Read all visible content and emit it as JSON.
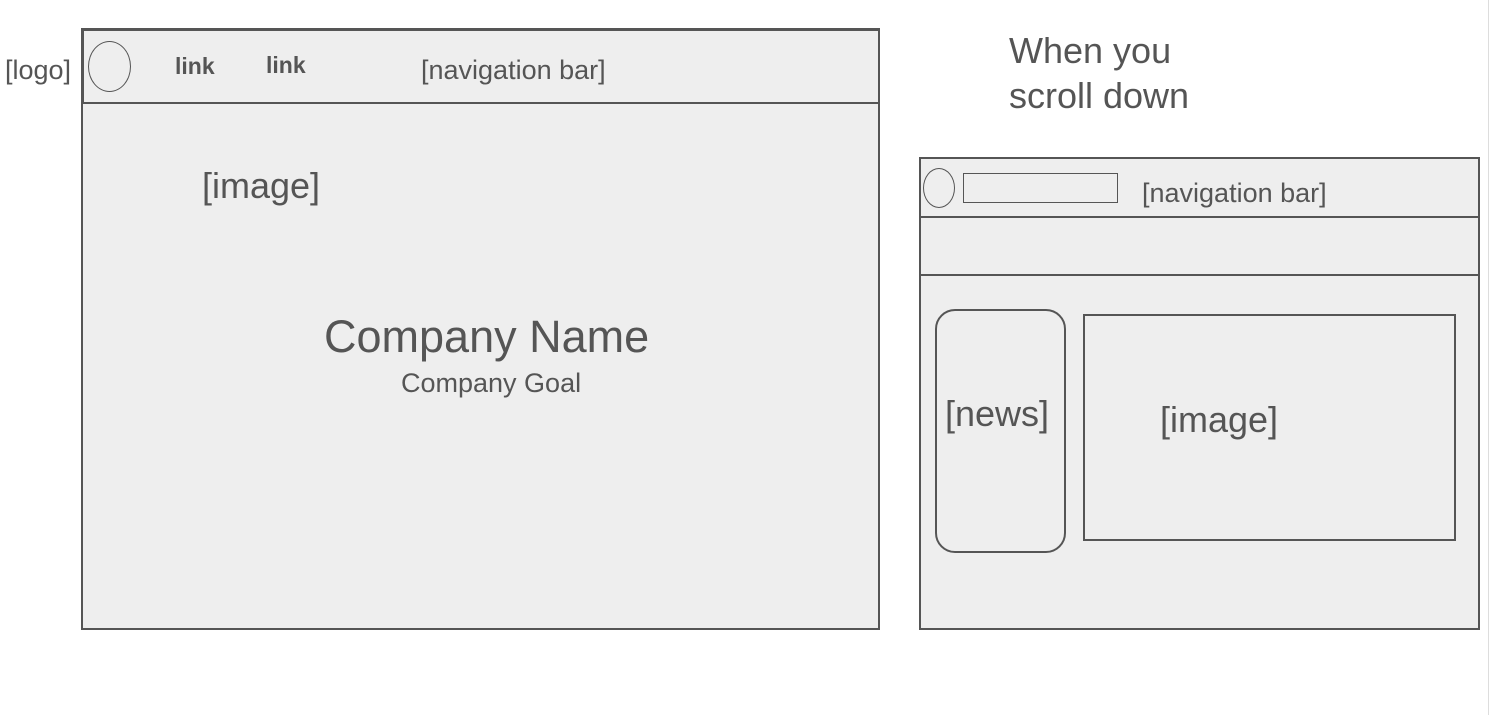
{
  "left_mockup": {
    "logo_label": "[logo]",
    "links": [
      "link",
      "link"
    ],
    "nav_label": "[navigation bar]",
    "image_label": "[image]",
    "company_name": "Company Name",
    "company_goal": "Company Goal"
  },
  "caption": "When you scroll down",
  "right_mockup": {
    "nav_label": "[navigation bar]",
    "news_label": "[news]",
    "image_label": "[image]"
  },
  "colors": {
    "stroke": "#555555",
    "fill": "#eeeeee",
    "text": "#555555"
  }
}
